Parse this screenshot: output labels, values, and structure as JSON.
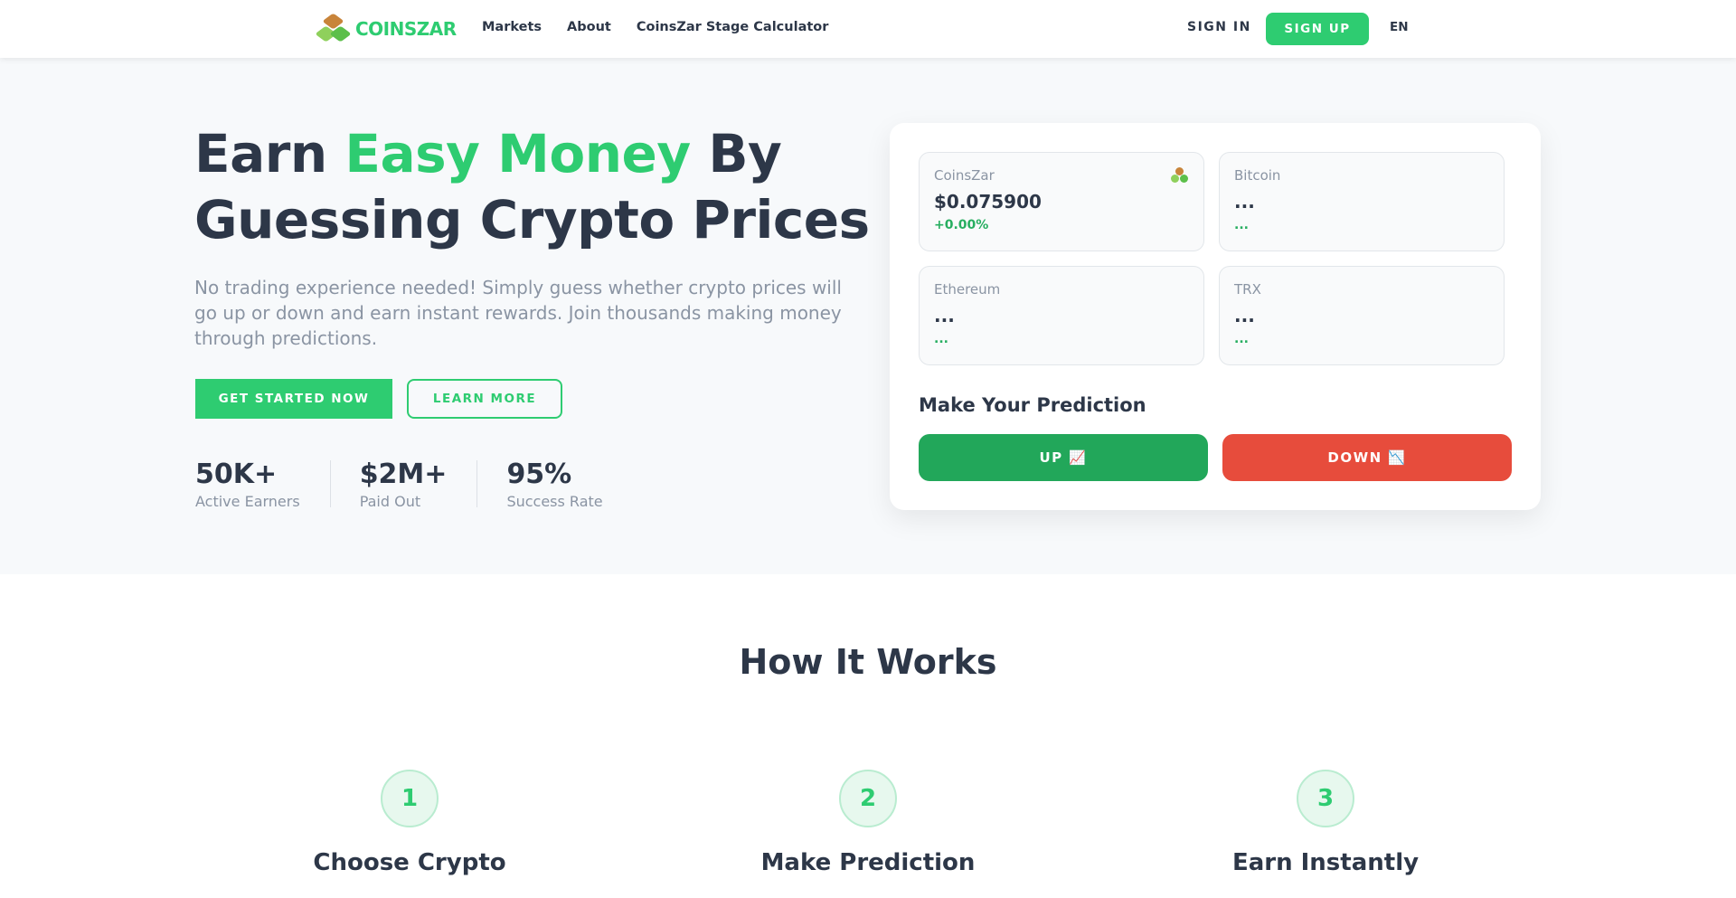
{
  "nav": {
    "logo_text": "COINSZAR",
    "links": [
      "Markets",
      "About",
      "CoinsZar Stage Calculator"
    ],
    "signin": "SIGN IN",
    "signup": "SIGN UP",
    "lang": "EN"
  },
  "hero": {
    "headline_part1": "Earn ",
    "headline_accent": "Easy Money",
    "headline_part2": " By",
    "headline_line2": "Guessing Crypto Prices",
    "subtext": "No trading experience needed! Simply guess whether crypto prices will go up or down and earn instant rewards. Join thousands making money through predictions.",
    "primary_cta": "GET STARTED NOW",
    "secondary_cta": "LEARN MORE",
    "stats": [
      {
        "value": "50K+",
        "label": "Active Earners"
      },
      {
        "value": "$2M+",
        "label": "Paid Out"
      },
      {
        "value": "95%",
        "label": "Success Rate"
      }
    ]
  },
  "prediction": {
    "coins": [
      {
        "name": "CoinsZar",
        "price": "$0.075900",
        "change": "+0.00%"
      },
      {
        "name": "Bitcoin",
        "price": "...",
        "change": "..."
      },
      {
        "name": "Ethereum",
        "price": "...",
        "change": "..."
      },
      {
        "name": "TRX",
        "price": "...",
        "change": "..."
      }
    ],
    "title": "Make Your Prediction",
    "up_label": "UP 📈",
    "down_label": "DOWN 📉"
  },
  "how": {
    "title": "How It Works",
    "steps": [
      {
        "number": "1",
        "title": "Choose Crypto"
      },
      {
        "number": "2",
        "title": "Make Prediction"
      },
      {
        "number": "3",
        "title": "Earn Instantly"
      }
    ]
  },
  "colors": {
    "brand_green": "#2ecc71",
    "up_green": "#22a75a",
    "down_red": "#e74c3c",
    "text_dark": "#2d3748"
  }
}
